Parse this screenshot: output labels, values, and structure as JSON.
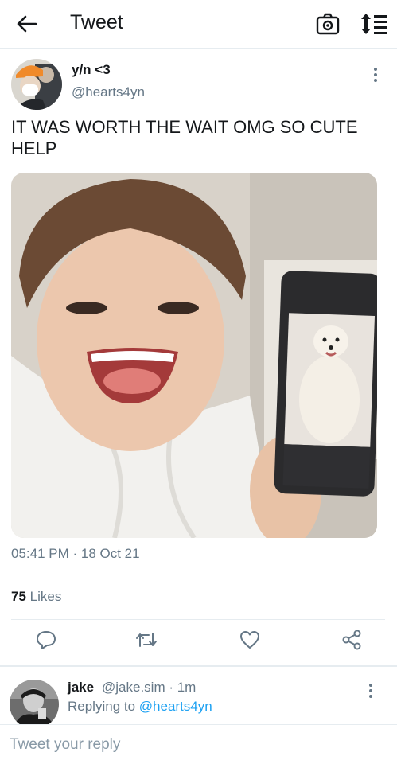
{
  "header": {
    "title": "Tweet",
    "back_icon": "arrow-left-icon",
    "camera_icon": "camera-icon",
    "sort_icon": "sort-icon"
  },
  "tweet": {
    "author_name": "y/n <3",
    "author_handle": "@hearts4yn",
    "text": "IT WAS WORTH THE WAIT OMG SO CUTE HELP",
    "timestamp": "05:41 PM · 18 Oct 21",
    "likes_count": "75",
    "likes_label": "Likes",
    "actions": [
      "reply-icon",
      "retweet-icon",
      "like-icon",
      "share-icon"
    ]
  },
  "reply": {
    "name": "jake",
    "handle_time": "@jake.sim · 1m",
    "replying_prefix": "Replying to",
    "replying_handle": "@hearts4yn"
  },
  "composer": {
    "placeholder": "Tweet your reply"
  },
  "colors": {
    "accent": "#1da1f2",
    "secondary_text": "#657786",
    "divider": "#e6ecf0"
  }
}
